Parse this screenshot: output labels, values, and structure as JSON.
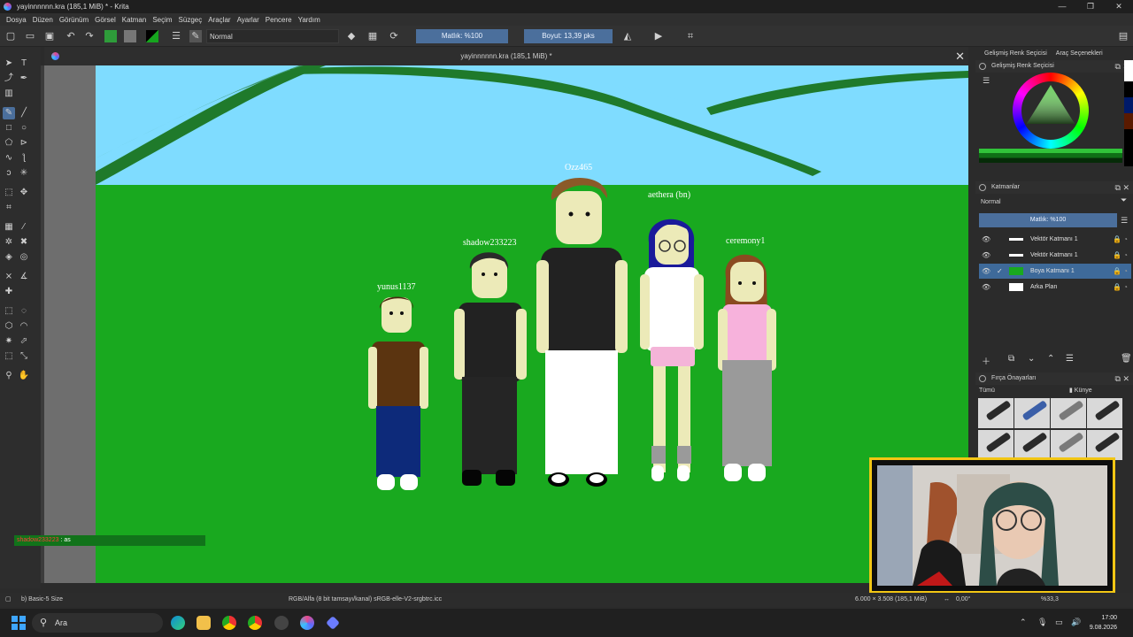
{
  "window": {
    "title": "yayinnnnnn.kra (185,1 MiB) * - Krita",
    "controls": [
      "—",
      "❐",
      "✕"
    ]
  },
  "menu": [
    "Dosya",
    "Düzen",
    "Görünüm",
    "Görsel",
    "Katman",
    "Seçim",
    "Süzgeç",
    "Araçlar",
    "Ayarlar",
    "Pencere",
    "Yardım"
  ],
  "toolbar": {
    "blend_mode": "Normal",
    "opacity": "Matlık: %100",
    "size": "Boyut: 13,39 pks"
  },
  "right_tabs": [
    "Gelişmiş Renk Seçicisi",
    "Araç Seçenekleri"
  ],
  "document": {
    "tab_title": "yayinnnnnn.kra (185,1 MiB) *"
  },
  "canvas": {
    "usernames": [
      "yunus1137",
      "shadow233223",
      "Ozz465",
      "aethera (bn)",
      "ceremony1"
    ],
    "chat": {
      "user": "shadow233223",
      "message": ": as"
    },
    "colors": {
      "sky": "#7fdcff",
      "grass": "#19a91f",
      "hill_line": "#1f7a2b"
    }
  },
  "color_selector": {
    "title": "Gelişmiş Renk Seçicisi"
  },
  "layers": {
    "title": "Katmanlar",
    "blend_mode": "Normal",
    "opacity": "Matlık: %100",
    "rows": [
      {
        "name": "Vektör Katmanı 1",
        "selected": false
      },
      {
        "name": "Vektör Katmanı 1",
        "selected": false
      },
      {
        "name": "Boya Katmanı 1",
        "selected": true
      },
      {
        "name": "Arka Plan",
        "selected": false
      }
    ]
  },
  "brush_presets": {
    "title": "Fırça Önayarları",
    "filter": "Tümü",
    "tag": "Künye"
  },
  "status": {
    "brush": "b) Basic-5 Size",
    "color_info": "RGB/Alfa (8 bit tamsayı/kanal) sRGB-elle-V2-srgbtrc.icc",
    "doc_size": "6.000 × 3.508 (185,1 MiB)",
    "rotation": "0,00°",
    "zoom": "%33,3"
  },
  "taskbar": {
    "search_placeholder": "Ara",
    "time": "17:00",
    "date": "9.08.2026"
  }
}
